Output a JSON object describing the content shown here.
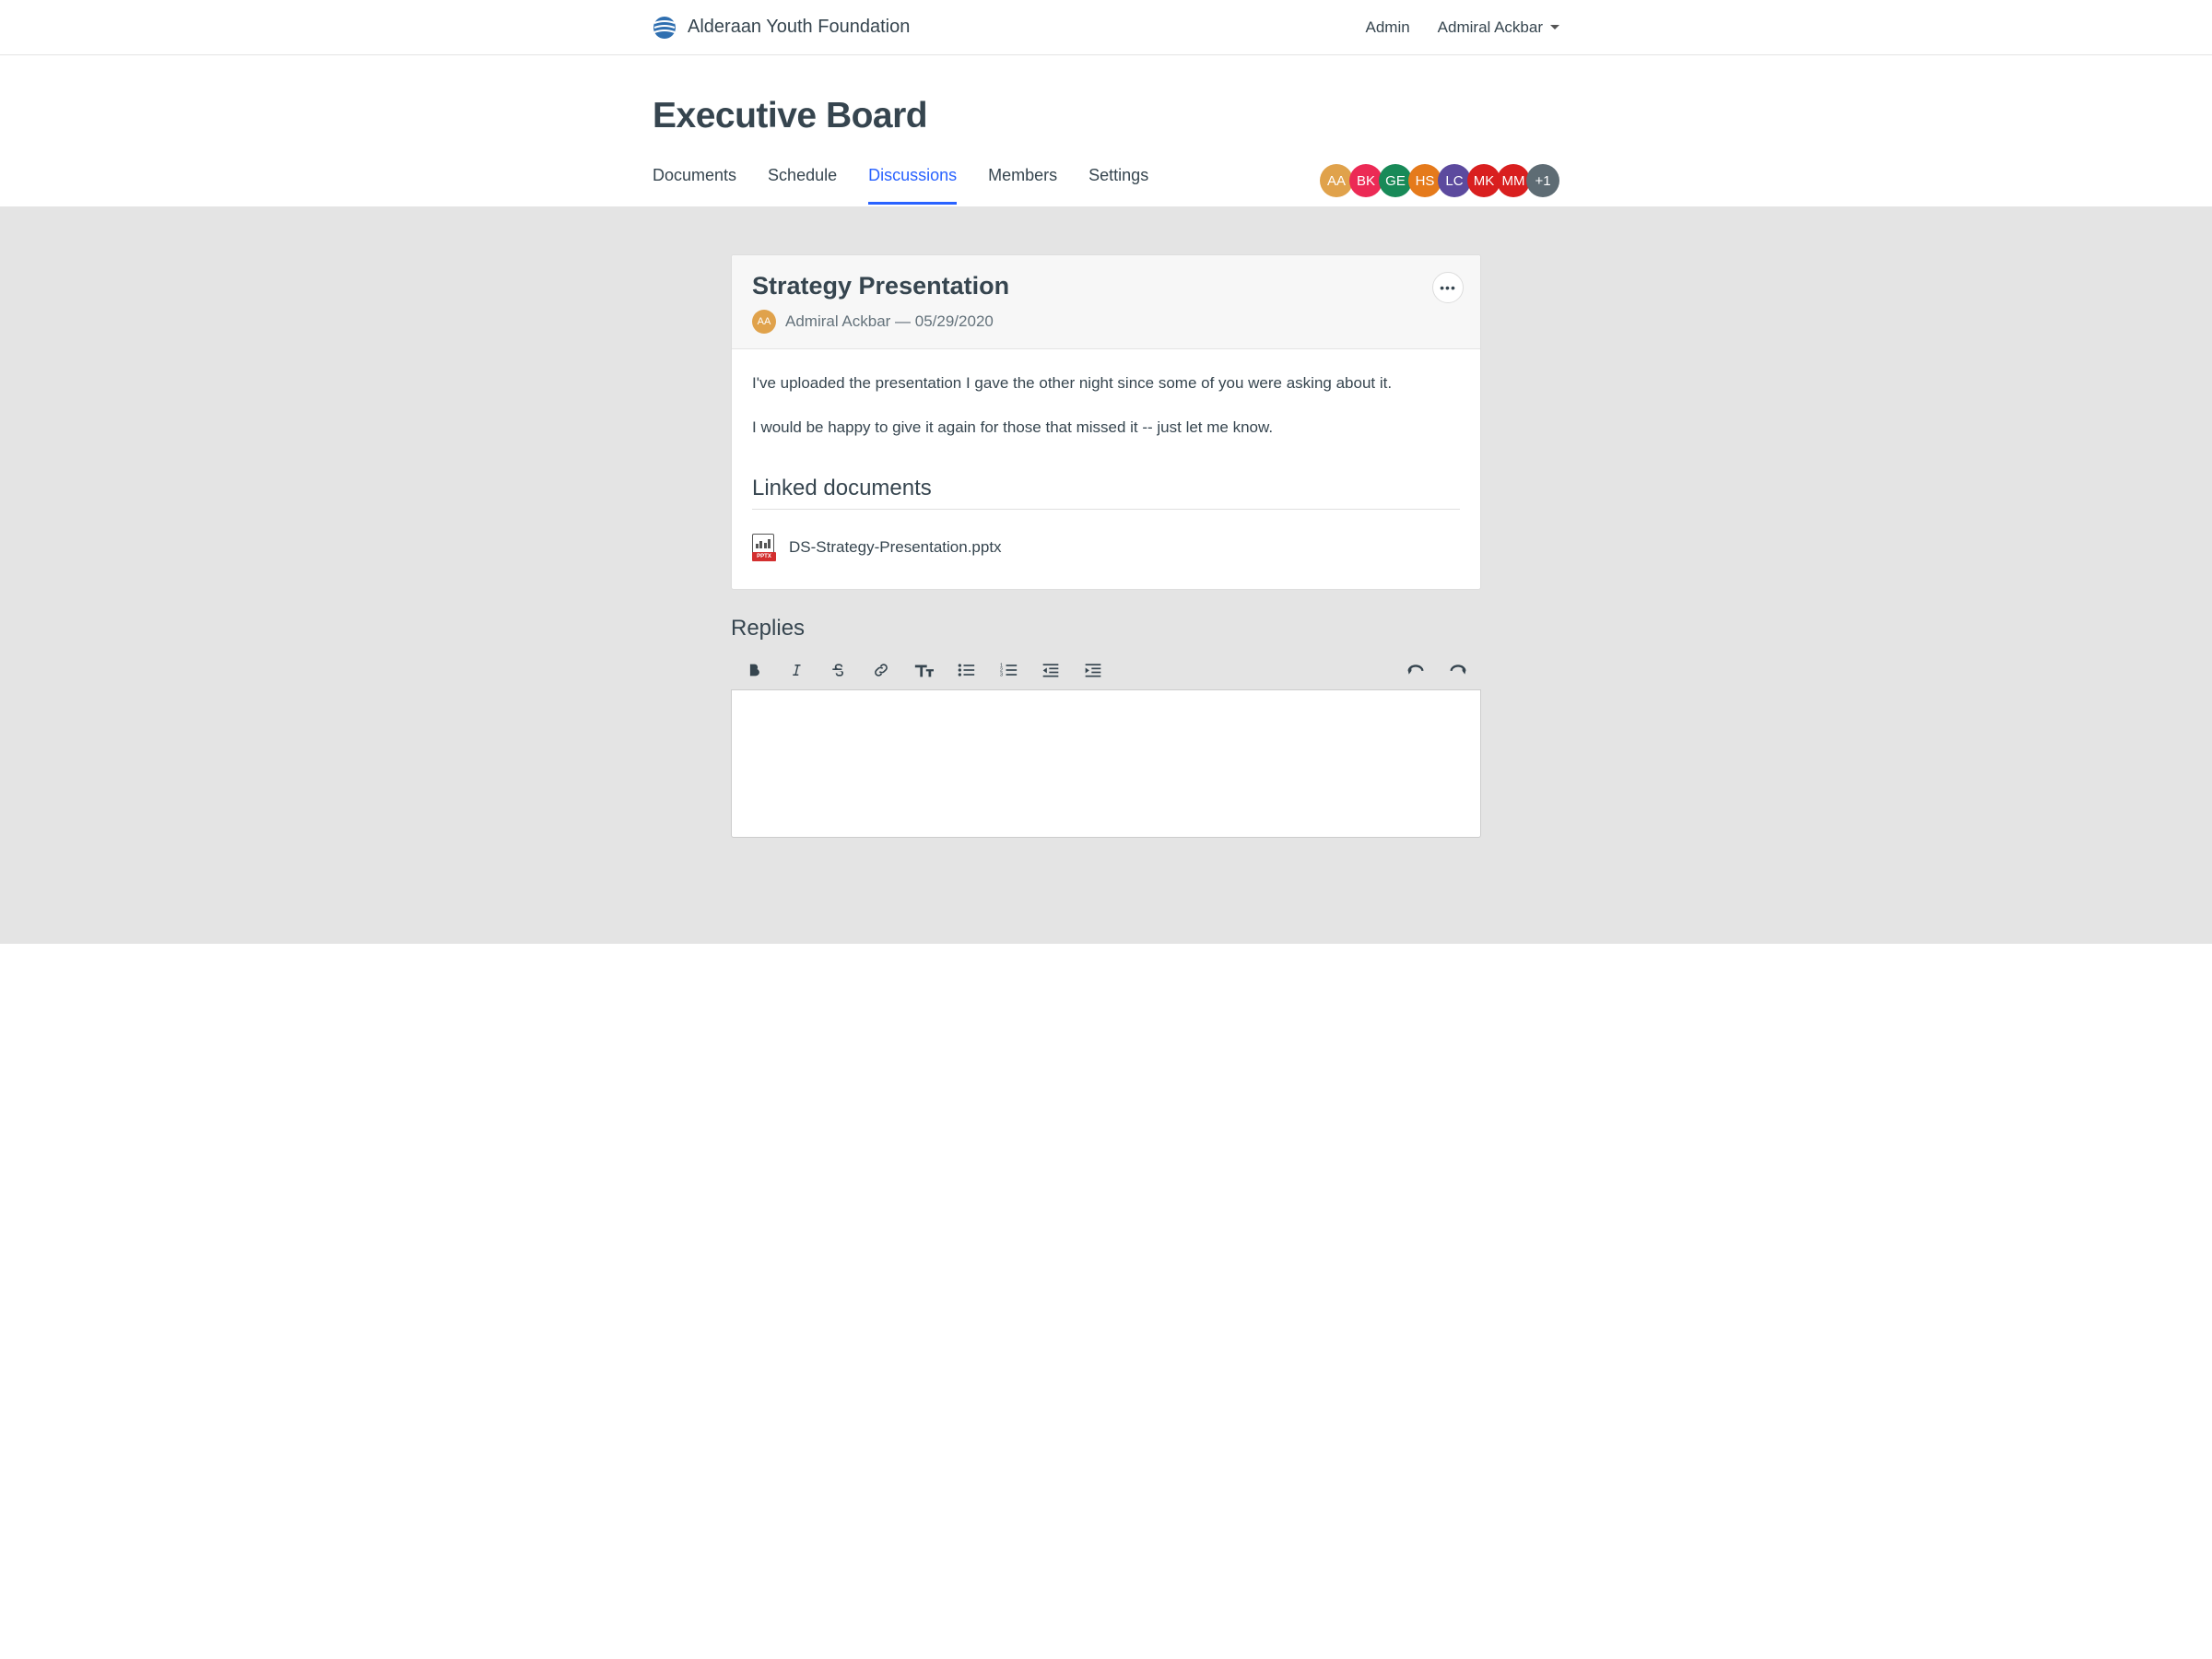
{
  "brand": {
    "name": "Alderaan Youth Foundation"
  },
  "topbar": {
    "admin_link": "Admin",
    "user_name": "Admiral Ackbar"
  },
  "page": {
    "title": "Executive Board"
  },
  "tabs": [
    {
      "label": "Documents"
    },
    {
      "label": "Schedule"
    },
    {
      "label": "Discussions"
    },
    {
      "label": "Members"
    },
    {
      "label": "Settings"
    }
  ],
  "active_tab_index": 2,
  "members": [
    {
      "initials": "AA",
      "color": "#e0a24b"
    },
    {
      "initials": "BK",
      "color": "#ec2a55"
    },
    {
      "initials": "GE",
      "color": "#188a58"
    },
    {
      "initials": "HS",
      "color": "#e57a1b"
    },
    {
      "initials": "LC",
      "color": "#5c4a9e"
    },
    {
      "initials": "MK",
      "color": "#d91f1f"
    },
    {
      "initials": "MM",
      "color": "#d91f1f"
    },
    {
      "initials": "+1",
      "color": "#5e6c74"
    }
  ],
  "discussion": {
    "title": "Strategy Presentation",
    "author_initials": "AA",
    "author_name": "Admiral Ackbar",
    "date": "05/29/2020",
    "meta_line": "Admiral Ackbar — 05/29/2020",
    "body_p1": "I've uploaded the presentation I gave the other night since some of you were asking about it.",
    "body_p2": "I would be happy to give it again for those that missed it -- just let me know.",
    "linked_heading": "Linked documents",
    "linked_doc_name": "DS-Strategy-Presentation.pptx",
    "linked_doc_badge": "PPTX"
  },
  "replies": {
    "heading": "Replies"
  },
  "toolbar_icons": [
    "bold",
    "italic",
    "strike",
    "link",
    "textsize",
    "bullets",
    "numbered",
    "outdent",
    "indent",
    "undo",
    "redo"
  ]
}
